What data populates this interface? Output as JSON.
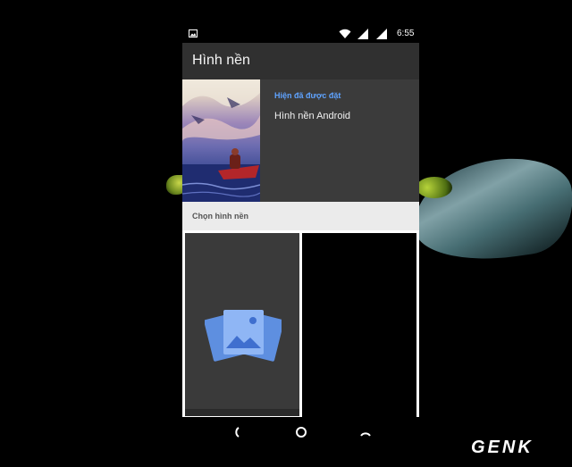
{
  "status_bar": {
    "time": "6:55",
    "icons": [
      "image-notification-icon",
      "wifi-icon",
      "signal-icon",
      "signal-icon"
    ]
  },
  "app_bar": {
    "title": "Hình nền"
  },
  "current_wallpaper": {
    "label": "Hiện đã được đặt",
    "name": "Hình nền Android"
  },
  "picker": {
    "section_title": "Chọn hình nền",
    "tiles": [
      {
        "icon": "gallery-photos-icon"
      },
      {
        "icon": ""
      }
    ]
  },
  "nav_bar": {
    "buttons": [
      "back-icon",
      "home-icon",
      "recents-icon"
    ]
  },
  "watermark": {
    "text": "GENK"
  },
  "colors": {
    "accent_label": "#5fa3ff",
    "app_bar_bg": "#303030",
    "section_header_bg": "#ebebeb"
  }
}
